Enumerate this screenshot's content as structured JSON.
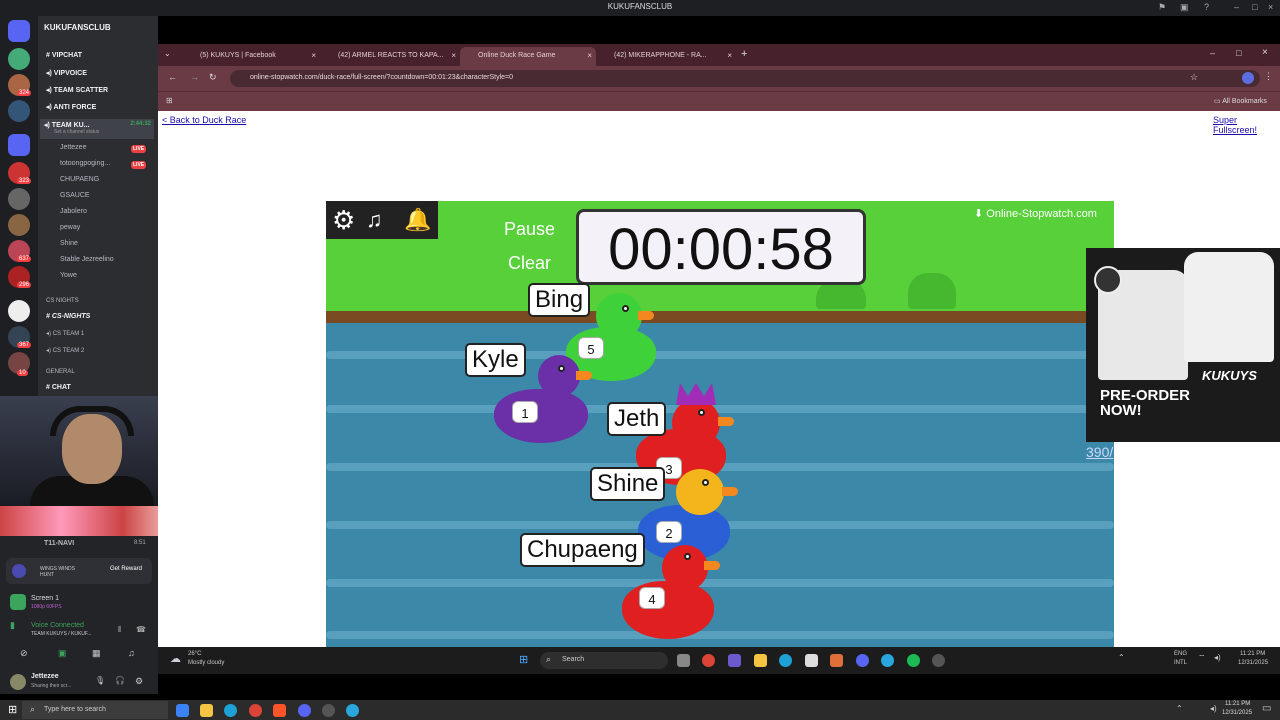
{
  "discord": {
    "window_title": "KUKUFANSCLUB",
    "server_name": "KUKUFANSCLUB",
    "server_badges": [
      "324",
      "323",
      "637",
      "296",
      "367",
      "10"
    ],
    "channels": [
      {
        "label": "VIPCHAT",
        "type": "text"
      },
      {
        "label": "VIPVOICE",
        "type": "voice"
      },
      {
        "label": "TEAM SCATTER",
        "type": "voice"
      },
      {
        "label": "ANTI FORCE",
        "type": "voice"
      },
      {
        "label": "TEAM KU...",
        "type": "voice",
        "time": "2:44:32",
        "status": "Set a channel status"
      }
    ],
    "voice_members": [
      {
        "name": "Jettezee",
        "live": "LIVE"
      },
      {
        "name": "totoongpoging...",
        "live": "LIVE"
      },
      {
        "name": "CHUPAENG",
        "live": ""
      },
      {
        "name": "GSAUCE",
        "live": ""
      },
      {
        "name": "Jabolero",
        "live": ""
      },
      {
        "name": "peway",
        "live": ""
      },
      {
        "name": "Shine",
        "live": ""
      },
      {
        "name": "Stable Jezreelino",
        "live": ""
      },
      {
        "name": "Yowe",
        "live": ""
      }
    ],
    "categories": [
      {
        "label": "CS NIGHTS"
      },
      {
        "label": "CS-NIGHTS"
      },
      {
        "label": "CS TEAM 1"
      },
      {
        "label": "CS TEAM 2"
      },
      {
        "label": "GENERAL"
      },
      {
        "label": "CHAT"
      }
    ],
    "second_voice": {
      "label": "T11-NAVI",
      "time": "8:51"
    },
    "promo": {
      "text": "WINGS WINDS HUNT",
      "button": "Get Reward"
    },
    "screen_share": {
      "title": "Screen 1",
      "subtitle": "1080p 60FPS"
    },
    "voice_status": {
      "title": "Voice Connected",
      "subtitle": "TEAM KUKUYS / KUKUF..."
    },
    "user": {
      "name": "Jettezee",
      "status": "Sharing their scr..."
    }
  },
  "browser": {
    "tabs": [
      {
        "label": "(5) KUKUYS | Facebook"
      },
      {
        "label": "(42) ARMEL REACTS TO KAPA..."
      },
      {
        "label": "Online Duck Race Game",
        "active": true
      },
      {
        "label": "(42) MIKERAPPHONE - RA..."
      }
    ],
    "url": "online-stopwatch.com/duck-race/full-screen/?countdown=00:01:23&characterStyle=0",
    "bookmarks_label": "All Bookmarks"
  },
  "page": {
    "back_link": "< Back to Duck Race",
    "fullscreen_link": "Super Fullscreen!"
  },
  "game": {
    "timer": "00:00:58",
    "pause_label": "Pause",
    "clear_label": "Clear",
    "brand": "Online-Stopwatch.com",
    "ducks": [
      {
        "name": "Bing",
        "number": "5",
        "color": "#3fd13a"
      },
      {
        "name": "Kyle",
        "number": "1",
        "color": "#6b2fa8"
      },
      {
        "name": "Jeth",
        "number": "3",
        "color": "#e02020"
      },
      {
        "name": "Shine",
        "number": "2",
        "color": "#2a5fd6"
      },
      {
        "name": "Chupaeng",
        "number": "4",
        "color": "#e02020"
      }
    ]
  },
  "ad": {
    "brand": "KUKUYS",
    "headline": "PRE-ORDER NOW!",
    "number": "390/"
  },
  "win11_taskbar": {
    "weather_temp": "26°C",
    "weather_desc": "Mostly cloudy",
    "search": "Search",
    "lang": "ENG",
    "lang2": "INTL",
    "time": "11:21 PM",
    "date": "12/31/2025"
  },
  "win10_taskbar": {
    "search_placeholder": "Type here to search",
    "time": "11:21 PM",
    "date": "12/31/2025"
  }
}
